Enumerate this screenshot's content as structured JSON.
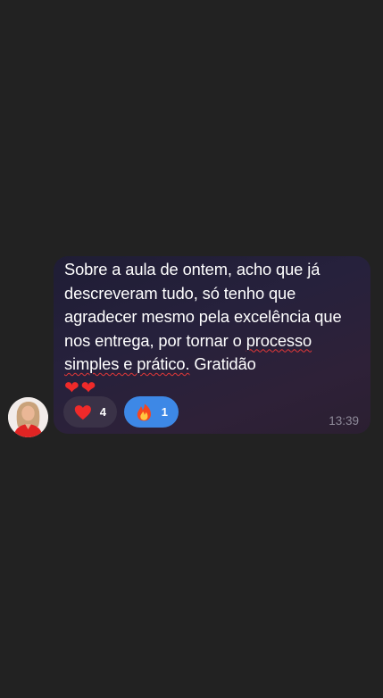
{
  "message": {
    "line_1": "Sobre a aula de ontem, acho que já descreveram tudo, só tenho que agradecer mesmo pela excelência que nos entrega, por tornar o ",
    "underlined": "processo simples e prático.",
    "line_end": " Gratidão",
    "emoji": "❤️❤️",
    "time": "13:39"
  },
  "reactions": [
    {
      "icon": "heart-icon",
      "count": "4"
    },
    {
      "icon": "fire-icon",
      "count": "1"
    }
  ],
  "colors": {
    "background": "#222222",
    "heart": "#ef2a2a",
    "fire_reaction_bg": "#3d88e6",
    "underline": "#e33838"
  }
}
